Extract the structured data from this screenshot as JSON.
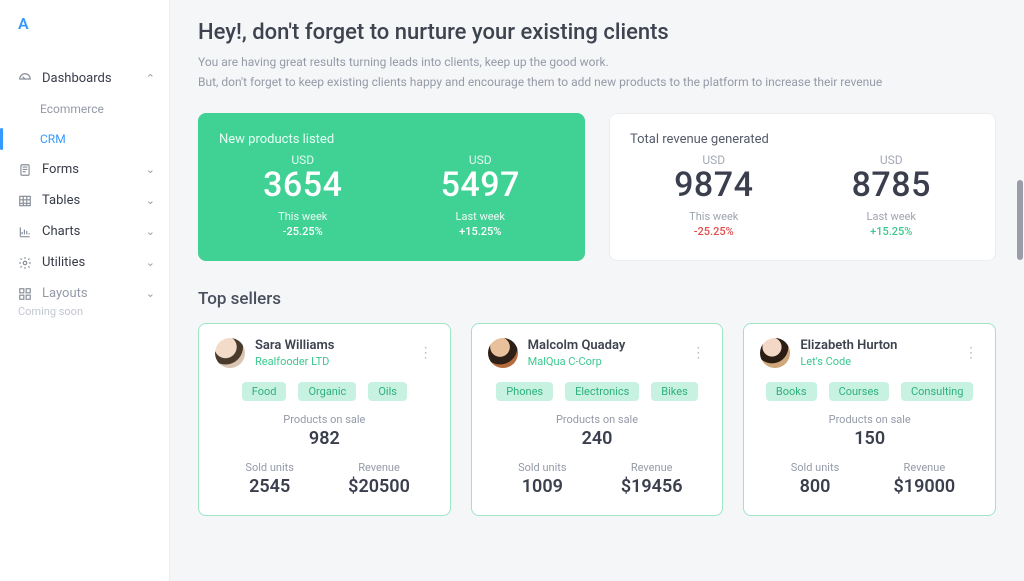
{
  "brand": "A",
  "sidebar": {
    "items": [
      {
        "label": "Dashboards",
        "expanded": true
      },
      {
        "label": "Forms"
      },
      {
        "label": "Tables"
      },
      {
        "label": "Charts"
      },
      {
        "label": "Utilities"
      },
      {
        "label": "Layouts",
        "soon": "Coming soon"
      }
    ],
    "dash_sub": [
      {
        "label": "Ecommerce"
      },
      {
        "label": "CRM",
        "active": true
      }
    ]
  },
  "headline": "Hey!, don't forget to nurture your existing clients",
  "subhead1": "You are having great results turning leads into clients, keep up the good work.",
  "subhead2": "But, don't forget to keep existing clients happy and encourage them to add new products to the platform to increase their revenue",
  "stats": {
    "left": {
      "title": "New products listed",
      "currency": "USD",
      "a_value": "3654",
      "a_period": "This week",
      "a_delta": "-25.25%",
      "b_value": "5497",
      "b_period": "Last week",
      "b_delta": "+15.25%"
    },
    "right": {
      "title": "Total revenue generated",
      "currency": "USD",
      "a_value": "9874",
      "a_period": "This week",
      "a_delta": "-25.25%",
      "b_value": "8785",
      "b_period": "Last week",
      "b_delta": "+15.25%"
    }
  },
  "top_sellers_title": "Top sellers",
  "sellers": [
    {
      "name": "Sara Williams",
      "org": "Realfooder LTD",
      "tags": [
        "Food",
        "Organic",
        "Oils"
      ],
      "products_label": "Products on sale",
      "products": "982",
      "units_label": "Sold units",
      "units": "2545",
      "revenue_label": "Revenue",
      "revenue": "$20500"
    },
    {
      "name": "Malcolm Quaday",
      "org": "MalQua C-Corp",
      "tags": [
        "Phones",
        "Electronics",
        "Bikes"
      ],
      "products_label": "Products on sale",
      "products": "240",
      "units_label": "Sold units",
      "units": "1009",
      "revenue_label": "Revenue",
      "revenue": "$19456"
    },
    {
      "name": "Elizabeth Hurton",
      "org": "Let's Code",
      "tags": [
        "Books",
        "Courses",
        "Consulting"
      ],
      "products_label": "Products on sale",
      "products": "150",
      "units_label": "Sold units",
      "units": "800",
      "revenue_label": "Revenue",
      "revenue": "$19000"
    }
  ]
}
